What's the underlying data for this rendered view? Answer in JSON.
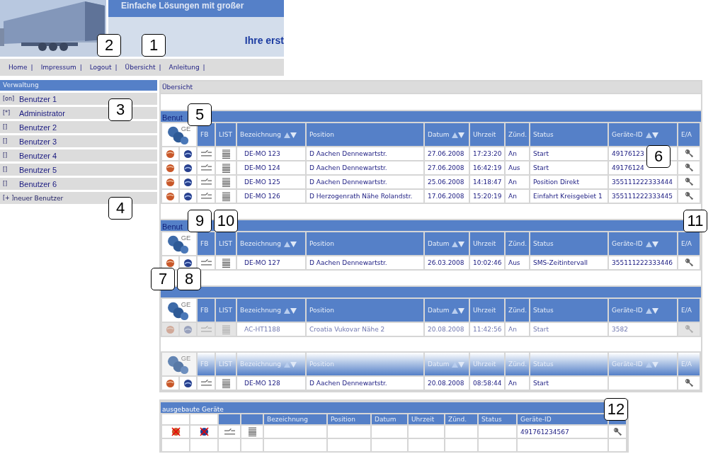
{
  "header": {
    "banner_title": "Einfache Lösungen mit großer",
    "tagline": "Ihre erst"
  },
  "nav": [
    {
      "label": "Home",
      "separator": "|"
    },
    {
      "label": "Impressum",
      "separator": "|"
    },
    {
      "label": "Logout",
      "separator": "|"
    },
    {
      "label": "Übersicht",
      "separator": "|"
    },
    {
      "label": "Anleitung",
      "separator": "|"
    }
  ],
  "sidebar": {
    "title": "Verwaltung",
    "items": [
      {
        "marker": "[on]",
        "label": "Benutzer 1"
      },
      {
        "marker": "[*]",
        "label": "Administrator"
      },
      {
        "marker": "[]",
        "label": "Benutzer 2"
      },
      {
        "marker": "[]",
        "label": "Benutzer 3"
      },
      {
        "marker": "[]",
        "label": "Benutzer 4"
      },
      {
        "marker": "[]",
        "label": "Benutzer 5"
      },
      {
        "marker": "[]",
        "label": "Benutzer 6"
      }
    ],
    "add_item": {
      "marker": "[+ ]",
      "label": "neuer Benutzer"
    }
  },
  "breadcrumb": "Übersicht",
  "groups": [
    {
      "title_bar": true,
      "title": "Benut",
      "header_faded": false,
      "icon_header": "GE",
      "columns": [
        {
          "label": "FB",
          "sortable": false
        },
        {
          "label": "LIST",
          "sortable": false
        },
        {
          "label": "Bezeichnung",
          "sortable": true
        },
        {
          "label": "Position",
          "sortable": false
        },
        {
          "label": "Datum",
          "sortable": true
        },
        {
          "label": "Uhrzeit",
          "sortable": false
        },
        {
          "label": "Zünd.",
          "sortable": false
        },
        {
          "label": "Status",
          "sortable": false
        },
        {
          "label": "Geräte-ID",
          "sortable": true
        },
        {
          "label": "E/A",
          "sortable": false
        }
      ],
      "rows": [
        {
          "name": "DE-MO 123",
          "position": "D Aachen Dennewartstr.",
          "date": "27.06.2008",
          "time": "17:23:20",
          "ignition": "An",
          "status": "Start",
          "device_id": "49176123",
          "faded": false
        },
        {
          "name": "DE-MO 124",
          "position": "D Aachen Dennewartstr.",
          "date": "27.06.2008",
          "time": "16:42:19",
          "ignition": "Aus",
          "status": "Start",
          "device_id": "49176124",
          "faded": false
        },
        {
          "name": "DE-MO 125",
          "position": "D Aachen Dennewartstr.",
          "date": "25.06.2008",
          "time": "14:18:47",
          "ignition": "An",
          "status": "Position Direkt",
          "device_id": "355111222333444",
          "faded": false
        },
        {
          "name": "DE-MO 126",
          "position": "D Herzogenrath Nähe Rolandstr.",
          "date": "17.06.2008",
          "time": "15:20:19",
          "ignition": "An",
          "status": "Einfahrt Kreisgebiet 1",
          "device_id": "355111222333445",
          "faded": false
        }
      ]
    },
    {
      "title_bar": true,
      "title": "Benut",
      "header_faded": false,
      "icon_header": "GE",
      "columns": [
        {
          "label": "FB",
          "sortable": false
        },
        {
          "label": "LIST",
          "sortable": false
        },
        {
          "label": "Bezeichnung",
          "sortable": true
        },
        {
          "label": "Position",
          "sortable": false
        },
        {
          "label": "Datum",
          "sortable": true
        },
        {
          "label": "Uhrzeit",
          "sortable": false
        },
        {
          "label": "Zünd.",
          "sortable": false
        },
        {
          "label": "Status",
          "sortable": false
        },
        {
          "label": "Geräte-ID",
          "sortable": true
        },
        {
          "label": "E/A",
          "sortable": false
        }
      ],
      "rows": [
        {
          "name": "DE-MO 127",
          "position": "D Aachen Dennewartstr.",
          "date": "26.03.2008",
          "time": "10:02:46",
          "ignition": "Aus",
          "status": "SMS-Zeitintervall",
          "device_id": "355111222333446",
          "faded": false
        }
      ]
    },
    {
      "title_bar": true,
      "header_faded": false,
      "icon_header": "GE",
      "columns": [
        {
          "label": "FB",
          "sortable": false
        },
        {
          "label": "LIST",
          "sortable": false
        },
        {
          "label": "Bezeichnung",
          "sortable": true
        },
        {
          "label": "Position",
          "sortable": false
        },
        {
          "label": "Datum",
          "sortable": true
        },
        {
          "label": "Uhrzeit",
          "sortable": false
        },
        {
          "label": "Zünd.",
          "sortable": false
        },
        {
          "label": "Status",
          "sortable": false
        },
        {
          "label": "Geräte-ID",
          "sortable": true
        },
        {
          "label": "E/A",
          "sortable": false
        }
      ],
      "rows": [
        {
          "name": "AC-HT1188",
          "position": "Croatia Vukovar Nähe 2",
          "date": "20.08.2008",
          "time": "11:42:56",
          "ignition": "An",
          "status": "Start",
          "device_id": "3582",
          "faded": true
        }
      ]
    },
    {
      "title_bar": false,
      "header_faded": true,
      "icon_header": "GE",
      "columns": [
        {
          "label": "FB",
          "sortable": false
        },
        {
          "label": "LIST",
          "sortable": false
        },
        {
          "label": "Bezeichnung",
          "sortable": true
        },
        {
          "label": "Position",
          "sortable": false
        },
        {
          "label": "Datum",
          "sortable": true
        },
        {
          "label": "Uhrzeit",
          "sortable": false
        },
        {
          "label": "Zünd.",
          "sortable": false
        },
        {
          "label": "Status",
          "sortable": false
        },
        {
          "label": "Geräte-ID",
          "sortable": true
        },
        {
          "label": "E/A",
          "sortable": false
        }
      ],
      "rows": [
        {
          "name": "DE-MO 128",
          "position": "D Aachen Dennewartstr.",
          "date": "20.08.2008",
          "time": "08:58:44",
          "ignition": "An",
          "status": "Start",
          "faded": false
        }
      ]
    }
  ],
  "removed": {
    "title": "ausgebaute Geräte",
    "columns": [
      "Bezeichnung",
      "Position",
      "Datum",
      "Uhrzeit",
      "Zünd.",
      "Status",
      "Geräte-ID"
    ],
    "rows": [
      {
        "device_id": "491761234567"
      }
    ]
  },
  "callouts": [
    {
      "label": "1"
    },
    {
      "label": "2"
    },
    {
      "label": "3"
    },
    {
      "label": "4"
    },
    {
      "label": "5"
    },
    {
      "label": "6"
    },
    {
      "label": "7"
    },
    {
      "label": "8"
    },
    {
      "label": "9"
    },
    {
      "label": "10"
    },
    {
      "label": "11"
    },
    {
      "label": "12"
    }
  ]
}
